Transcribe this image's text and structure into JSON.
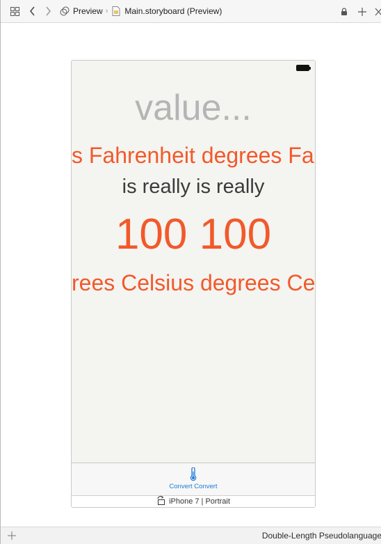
{
  "jumpbar": {
    "crumbs": [
      "Preview",
      "Main.storyboard (Preview)"
    ]
  },
  "device_screen": {
    "value_text": "value...",
    "fahrenheit_text": "s Fahrenheit degrees Fah",
    "really_text": "is really is really",
    "number_text": "100 100",
    "celsius_text": "rees Celsius degrees Ce",
    "tab_label": "Convert Convert"
  },
  "device_label": "iPhone 7 | Portrait",
  "bottombar": {
    "language": "Double-Length Pseudolanguage"
  },
  "colors": {
    "accent_orange": "#f2592a",
    "tab_blue": "#1c7cd6",
    "placeholder_gray": "#b5b5b5",
    "text_dark": "#3b3b3b"
  },
  "icons": [
    "grid-icon",
    "back-arrow-icon",
    "forward-arrow-icon",
    "preview-icon",
    "storyboard-file-icon",
    "lock-icon",
    "add-icon",
    "close-icon",
    "battery-icon",
    "thermometer-icon",
    "rotate-icon"
  ]
}
